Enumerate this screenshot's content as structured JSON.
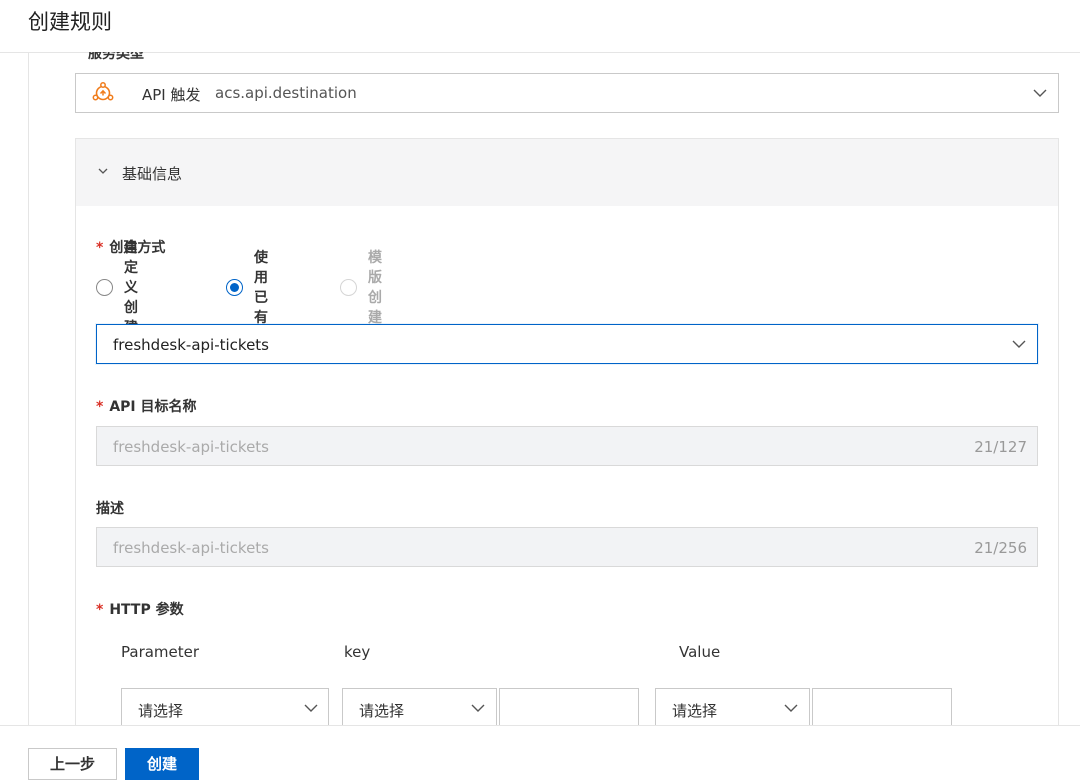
{
  "page": {
    "title": "创建规则",
    "cut_label": "服务类型"
  },
  "service_select": {
    "label": "API 触发",
    "value": "acs.api.destination",
    "icon": "api-trigger-icon"
  },
  "panel": {
    "title": "基础信息"
  },
  "create_method": {
    "label": "创建方式",
    "options": [
      {
        "label": "自定义创建",
        "checked": false,
        "disabled": false
      },
      {
        "label": "使用已有",
        "checked": true,
        "disabled": false
      },
      {
        "label": "模版创建",
        "checked": false,
        "disabled": true
      }
    ],
    "selected_value": "freshdesk-api-tickets"
  },
  "api_target_name": {
    "label": "API 目标名称",
    "value": "freshdesk-api-tickets",
    "count": "21/127"
  },
  "description": {
    "label": "描述",
    "value": "freshdesk-api-tickets",
    "count": "21/256"
  },
  "http_params": {
    "label": "HTTP 参数",
    "columns": [
      "Parameter",
      "key",
      "Value"
    ],
    "row": {
      "parameter_placeholder": "请选择",
      "key_placeholder": "请选择",
      "value_placeholder": "请选择"
    }
  },
  "footer": {
    "prev_label": "上一步",
    "create_label": "创建"
  },
  "colors": {
    "accent": "#0064c8",
    "required": "#d93026",
    "panel_header_bg": "#f5f5f6",
    "disabled_bg": "#f2f3f5"
  }
}
